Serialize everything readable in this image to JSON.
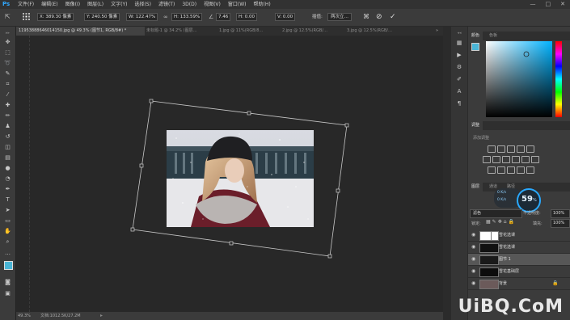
{
  "app": {
    "logo": "Ps"
  },
  "menu": [
    "文件(F)",
    "编辑(E)",
    "图像(I)",
    "图层(L)",
    "文字(Y)",
    "选择(S)",
    "滤镜(T)",
    "3D(D)",
    "视图(V)",
    "窗口(W)",
    "帮助(H)"
  ],
  "window_controls": [
    "—",
    "□",
    "✕"
  ],
  "options": {
    "x": "X: 389.30 像素",
    "y": "Y: 240.50 像素",
    "w": "W: 122.47%",
    "h": "H: 133.59%",
    "angle": "7.46",
    "hskew": "H: 0.00",
    "vskew": "V: 0.00",
    "interp_label": "插值:",
    "interp_value": "两次立…",
    "cancel": "⊘",
    "commit": "✓"
  },
  "tabs": [
    "1195388864601415​0.jpg @ 49.3% (图节1, RGB/8#) *",
    "未标题-1 @ 34.2% (图层…",
    "1.jpg @ 11%(RGB/8…",
    "2.jpg @ 12.5%(RGB/…",
    "3.jpg @ 12.5%(RGB/…"
  ],
  "status": {
    "zoom": "49.3%",
    "doc": "文档:1012.5K/27.2M"
  },
  "panels": {
    "color_tabs": [
      "颜色",
      "色板"
    ],
    "adjust_tab": "调整",
    "adjust_hint": "添加调整",
    "layers_tabs": [
      "图层",
      "通道",
      "路径"
    ],
    "blend_mode": "滤色",
    "opacity_label": "不透明度:",
    "opacity": "100%",
    "lock_label": "锁定:",
    "fill_label": "填充:",
    "fill": "100%",
    "meter": {
      "value": "59",
      "unit": "%",
      "up": "0 K/s",
      "down": "0 K/s"
    },
    "layers": [
      {
        "name": "雪花选课",
        "selected": false
      },
      {
        "name": "雪花选课",
        "selected": false
      },
      {
        "name": "图节 1",
        "selected": true
      },
      {
        "name": "雪花基础层",
        "selected": false
      },
      {
        "name": "背景",
        "selected": false
      }
    ]
  },
  "watermark": "UiBQ.CoM",
  "colors": {
    "foreground": "#4ab5d6",
    "background": "#111111",
    "accent": "#31a8ff"
  }
}
